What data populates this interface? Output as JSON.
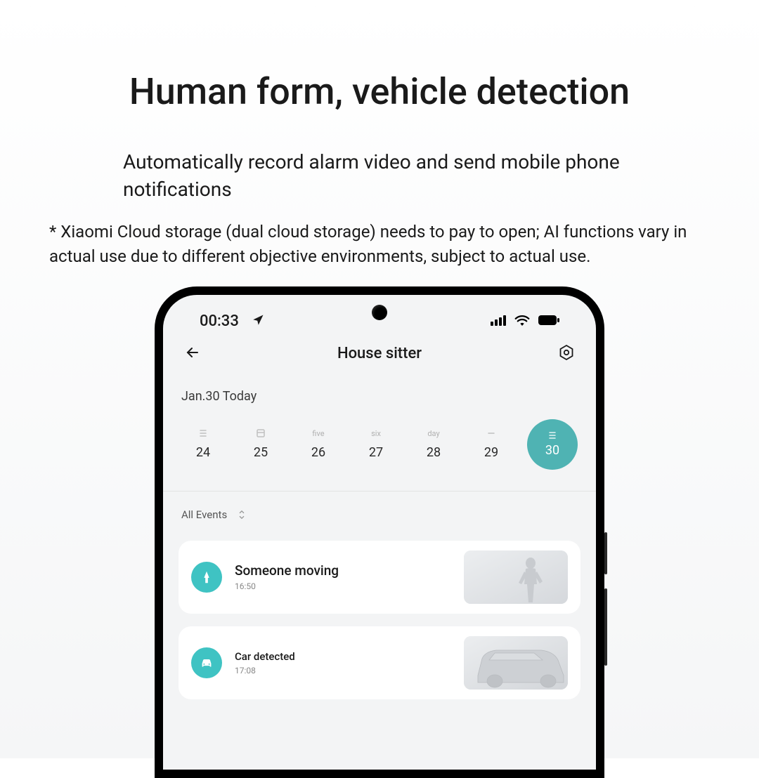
{
  "headline": "Human form, vehicle detection",
  "sub": "Automatically record alarm video and send mobile phone notifications",
  "note": "* Xiaomi Cloud storage (dual cloud storage) needs to pay to open; AI functions vary in actual use due to different objective environments, subject to actual use.",
  "statusbar": {
    "time": "00:33"
  },
  "appbar": {
    "title": "House sitter"
  },
  "date_label": "Jan.30 Today",
  "calendar": [
    {
      "top": "icon-lines",
      "num": "24"
    },
    {
      "top": "icon-box",
      "num": "25"
    },
    {
      "top": "five",
      "num": "26"
    },
    {
      "top": "six",
      "num": "27"
    },
    {
      "top": "day",
      "num": "28"
    },
    {
      "top": "icon-dash",
      "num": "29"
    },
    {
      "top": "icon-lines",
      "num": "30",
      "selected": true
    }
  ],
  "filter": {
    "label": "All Events"
  },
  "events": [
    {
      "icon": "person",
      "title": "Someone moving",
      "time": "16:50",
      "thumb": "person"
    },
    {
      "icon": "car",
      "title": "Car detected",
      "time": "17:08",
      "thumb": "car",
      "small": true
    }
  ]
}
